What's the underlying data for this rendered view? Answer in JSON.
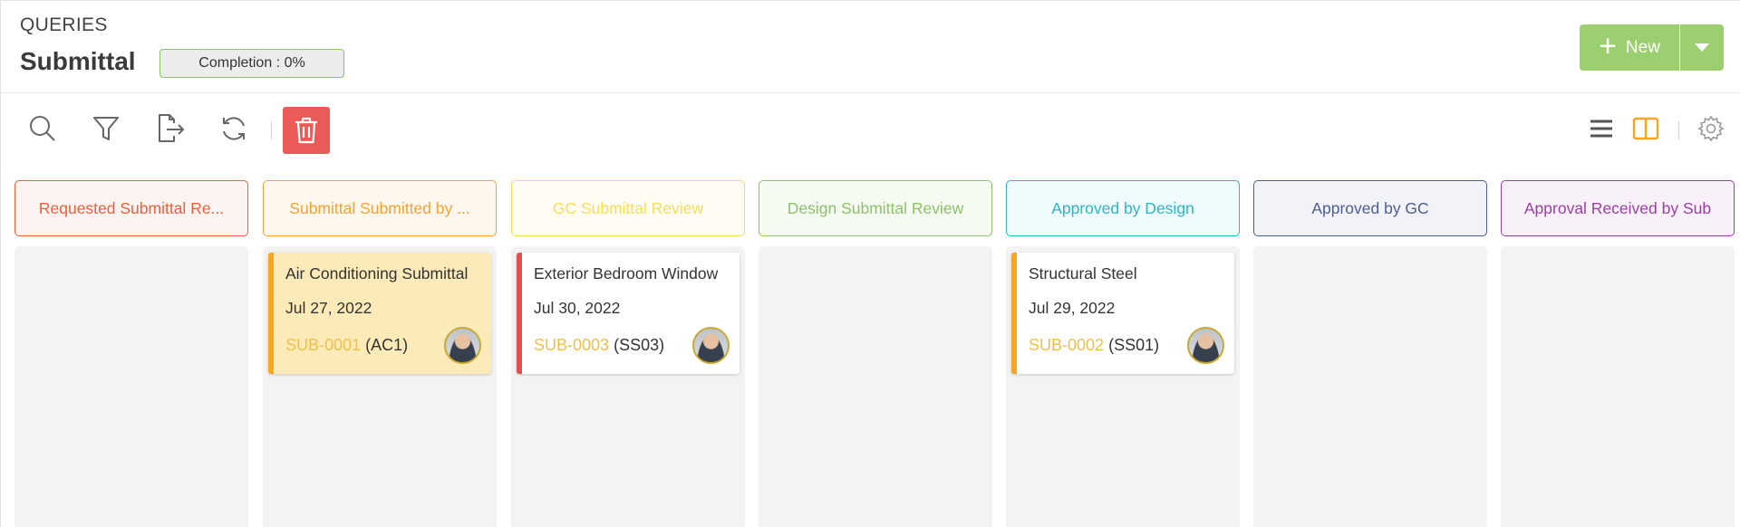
{
  "header": {
    "section": "QUERIES",
    "title": "Submittal",
    "completion": "Completion : 0%",
    "new_label": "New"
  },
  "toolbar": {
    "icons": [
      "search-icon",
      "filter-icon",
      "export-icon",
      "refresh-icon",
      "trash-icon",
      "list-view-icon",
      "board-view-icon",
      "gear-icon"
    ],
    "delete_color": "#ea5b57",
    "active_view": "board"
  },
  "columns": [
    {
      "label": "Requested Submittal Re...",
      "color": "#e8603c",
      "bg": "#fdf3f0",
      "cards": []
    },
    {
      "label": "Submittal Submitted by ...",
      "color": "#f5a236",
      "bg": "#fef7ee",
      "cards": [
        {
          "title": "Air Conditioning Submittal",
          "date": "Jul 27, 2022",
          "id": "SUB-0001",
          "ref": "(AC1)",
          "accent": "#f5a623",
          "highlight": true
        }
      ]
    },
    {
      "label": "GC Submittal Review",
      "color": "#f5dd5c",
      "bg": "#fffdf3",
      "cards": [
        {
          "title": "Exterior Bedroom Window",
          "date": "Jul 30, 2022",
          "id": "SUB-0003",
          "ref": "(SS03)",
          "accent": "#e44f4f",
          "highlight": false
        }
      ]
    },
    {
      "label": "Design Submittal Review",
      "color": "#8cc26b",
      "bg": "#f6fbf2",
      "cards": []
    },
    {
      "label": "Approved by Design",
      "color": "#2bb6c9",
      "bg": "#f0fbfd",
      "cards": [
        {
          "title": "Structural Steel",
          "date": "Jul 29, 2022",
          "id": "SUB-0002",
          "ref": "(SS01)",
          "accent": "#f5a623",
          "highlight": false
        }
      ]
    },
    {
      "label": "Approved by GC",
      "color": "#4f5d8f",
      "bg": "#f2f3f8",
      "cards": []
    },
    {
      "label": "Approval Received by Sub",
      "color": "#9b3fa6",
      "bg": "#f9f1fa",
      "cards": []
    }
  ]
}
